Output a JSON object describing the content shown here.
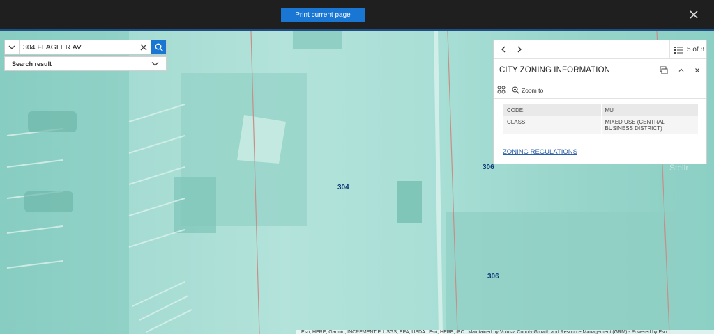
{
  "topbar": {
    "print_label": "Print current page"
  },
  "search": {
    "value": "304 FLAGLER AV",
    "results_label": "Search result"
  },
  "map": {
    "parcel_labels": [
      "304",
      "306",
      "306"
    ],
    "watermark": "Stellr",
    "attribution": "Esri, HERE, Garmin, INCREMENT P, USGS, EPA, USDA | Esri, HERE, iPC | Maintained by Volusia County Growth and Resource Management (GRM) - Powered by Esri"
  },
  "popup": {
    "pager": "5 of 8",
    "title": "CITY ZONING INFORMATION",
    "zoom_label": "Zoom to",
    "attributes": [
      {
        "key": "CODE:",
        "value": "MU"
      },
      {
        "key": "CLASS:",
        "value": "MIXED USE (CENTRAL BUSINESS DISTRICT)"
      }
    ],
    "link_label": "ZONING REGULATIONS"
  },
  "colors": {
    "accent": "#1976d2",
    "topbar": "#1f1f1f",
    "map_tint": "#9fd8cf",
    "link": "#2a5fa8"
  }
}
